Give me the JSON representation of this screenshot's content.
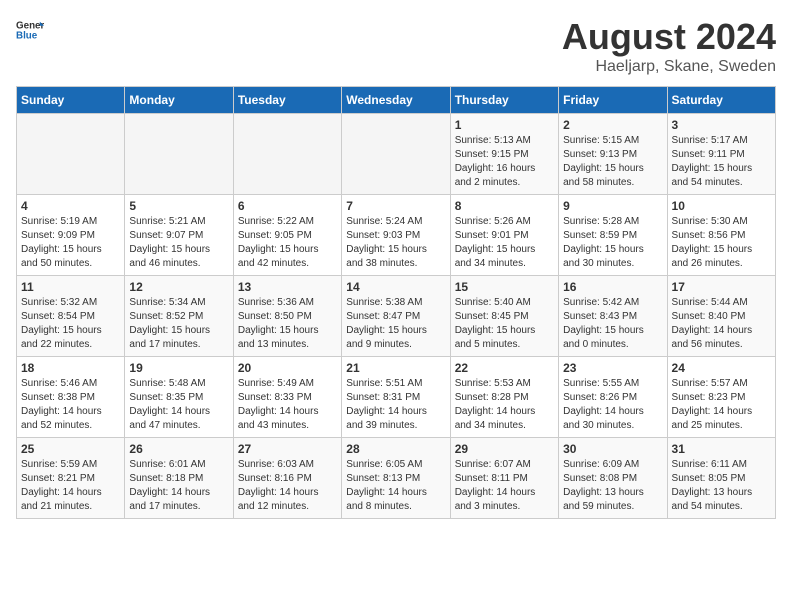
{
  "header": {
    "logo_general": "General",
    "logo_blue": "Blue",
    "main_title": "August 2024",
    "subtitle": "Haeljarp, Skane, Sweden"
  },
  "calendar": {
    "days_of_week": [
      "Sunday",
      "Monday",
      "Tuesday",
      "Wednesday",
      "Thursday",
      "Friday",
      "Saturday"
    ],
    "weeks": [
      [
        {
          "day": "",
          "info": ""
        },
        {
          "day": "",
          "info": ""
        },
        {
          "day": "",
          "info": ""
        },
        {
          "day": "",
          "info": ""
        },
        {
          "day": "1",
          "info": "Sunrise: 5:13 AM\nSunset: 9:15 PM\nDaylight: 16 hours\nand 2 minutes."
        },
        {
          "day": "2",
          "info": "Sunrise: 5:15 AM\nSunset: 9:13 PM\nDaylight: 15 hours\nand 58 minutes."
        },
        {
          "day": "3",
          "info": "Sunrise: 5:17 AM\nSunset: 9:11 PM\nDaylight: 15 hours\nand 54 minutes."
        }
      ],
      [
        {
          "day": "4",
          "info": "Sunrise: 5:19 AM\nSunset: 9:09 PM\nDaylight: 15 hours\nand 50 minutes."
        },
        {
          "day": "5",
          "info": "Sunrise: 5:21 AM\nSunset: 9:07 PM\nDaylight: 15 hours\nand 46 minutes."
        },
        {
          "day": "6",
          "info": "Sunrise: 5:22 AM\nSunset: 9:05 PM\nDaylight: 15 hours\nand 42 minutes."
        },
        {
          "day": "7",
          "info": "Sunrise: 5:24 AM\nSunset: 9:03 PM\nDaylight: 15 hours\nand 38 minutes."
        },
        {
          "day": "8",
          "info": "Sunrise: 5:26 AM\nSunset: 9:01 PM\nDaylight: 15 hours\nand 34 minutes."
        },
        {
          "day": "9",
          "info": "Sunrise: 5:28 AM\nSunset: 8:59 PM\nDaylight: 15 hours\nand 30 minutes."
        },
        {
          "day": "10",
          "info": "Sunrise: 5:30 AM\nSunset: 8:56 PM\nDaylight: 15 hours\nand 26 minutes."
        }
      ],
      [
        {
          "day": "11",
          "info": "Sunrise: 5:32 AM\nSunset: 8:54 PM\nDaylight: 15 hours\nand 22 minutes."
        },
        {
          "day": "12",
          "info": "Sunrise: 5:34 AM\nSunset: 8:52 PM\nDaylight: 15 hours\nand 17 minutes."
        },
        {
          "day": "13",
          "info": "Sunrise: 5:36 AM\nSunset: 8:50 PM\nDaylight: 15 hours\nand 13 minutes."
        },
        {
          "day": "14",
          "info": "Sunrise: 5:38 AM\nSunset: 8:47 PM\nDaylight: 15 hours\nand 9 minutes."
        },
        {
          "day": "15",
          "info": "Sunrise: 5:40 AM\nSunset: 8:45 PM\nDaylight: 15 hours\nand 5 minutes."
        },
        {
          "day": "16",
          "info": "Sunrise: 5:42 AM\nSunset: 8:43 PM\nDaylight: 15 hours\nand 0 minutes."
        },
        {
          "day": "17",
          "info": "Sunrise: 5:44 AM\nSunset: 8:40 PM\nDaylight: 14 hours\nand 56 minutes."
        }
      ],
      [
        {
          "day": "18",
          "info": "Sunrise: 5:46 AM\nSunset: 8:38 PM\nDaylight: 14 hours\nand 52 minutes."
        },
        {
          "day": "19",
          "info": "Sunrise: 5:48 AM\nSunset: 8:35 PM\nDaylight: 14 hours\nand 47 minutes."
        },
        {
          "day": "20",
          "info": "Sunrise: 5:49 AM\nSunset: 8:33 PM\nDaylight: 14 hours\nand 43 minutes."
        },
        {
          "day": "21",
          "info": "Sunrise: 5:51 AM\nSunset: 8:31 PM\nDaylight: 14 hours\nand 39 minutes."
        },
        {
          "day": "22",
          "info": "Sunrise: 5:53 AM\nSunset: 8:28 PM\nDaylight: 14 hours\nand 34 minutes."
        },
        {
          "day": "23",
          "info": "Sunrise: 5:55 AM\nSunset: 8:26 PM\nDaylight: 14 hours\nand 30 minutes."
        },
        {
          "day": "24",
          "info": "Sunrise: 5:57 AM\nSunset: 8:23 PM\nDaylight: 14 hours\nand 25 minutes."
        }
      ],
      [
        {
          "day": "25",
          "info": "Sunrise: 5:59 AM\nSunset: 8:21 PM\nDaylight: 14 hours\nand 21 minutes."
        },
        {
          "day": "26",
          "info": "Sunrise: 6:01 AM\nSunset: 8:18 PM\nDaylight: 14 hours\nand 17 minutes."
        },
        {
          "day": "27",
          "info": "Sunrise: 6:03 AM\nSunset: 8:16 PM\nDaylight: 14 hours\nand 12 minutes."
        },
        {
          "day": "28",
          "info": "Sunrise: 6:05 AM\nSunset: 8:13 PM\nDaylight: 14 hours\nand 8 minutes."
        },
        {
          "day": "29",
          "info": "Sunrise: 6:07 AM\nSunset: 8:11 PM\nDaylight: 14 hours\nand 3 minutes."
        },
        {
          "day": "30",
          "info": "Sunrise: 6:09 AM\nSunset: 8:08 PM\nDaylight: 13 hours\nand 59 minutes."
        },
        {
          "day": "31",
          "info": "Sunrise: 6:11 AM\nSunset: 8:05 PM\nDaylight: 13 hours\nand 54 minutes."
        }
      ]
    ]
  }
}
